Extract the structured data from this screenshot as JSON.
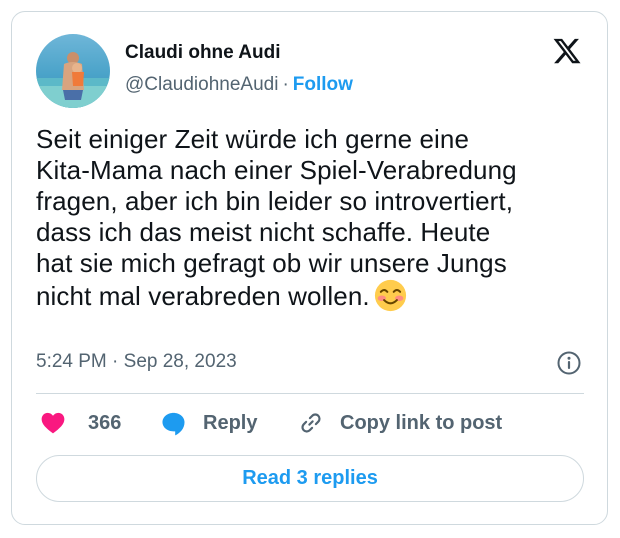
{
  "author": {
    "display_name": "Claudi ohne Audi",
    "handle": "@ClaudiohneAudi",
    "separator": "·",
    "follow_label": "Follow",
    "avatar_icon": "profile-photo-beach-avatar"
  },
  "platform_icon": "x-logo-icon",
  "tweet": {
    "text_lines": [
      "Seit einiger Zeit würde ich gerne eine",
      "Kita-Mama nach einer Spiel-Verabredung",
      "fragen, aber ich bin leider so introvertiert,",
      "dass ich das meist nicht schaffe. Heute",
      "hat sie mich gefragt ob wir unsere Jungs",
      "nicht mal verabreden wollen."
    ],
    "emoji": "smiling-face-with-smiling-eyes-emoji",
    "time": "5:24 PM",
    "meta_separator": "·",
    "date": "Sep 28, 2023"
  },
  "actions": {
    "like_count": "366",
    "reply_label": "Reply",
    "copy_label": "Copy link to post"
  },
  "read_replies_label": "Read 3 replies",
  "colors": {
    "accent": "#1d9bf0",
    "like": "#f91880",
    "text": "#0f1419",
    "secondary": "#536471",
    "border": "#cfd9de"
  }
}
